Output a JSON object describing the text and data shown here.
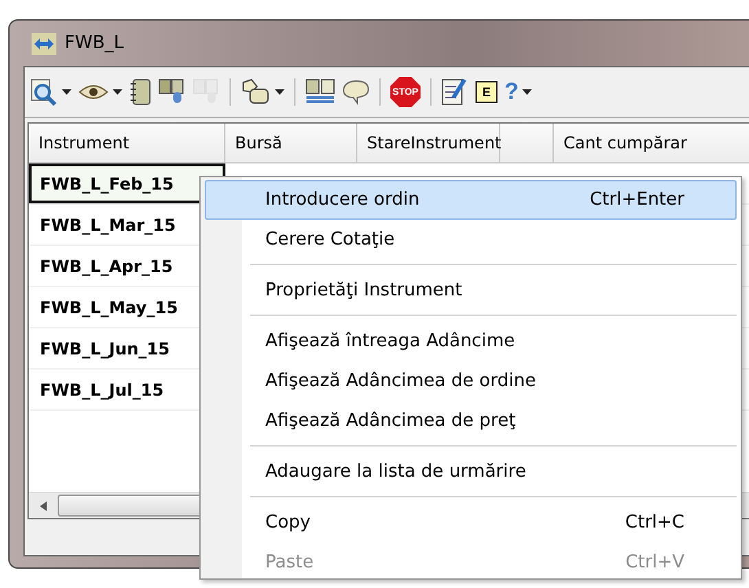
{
  "window": {
    "title": "FWB_L"
  },
  "toolbar": [
    {
      "kind": "zoom",
      "disabled": false
    },
    {
      "kind": "caret",
      "disabled": false
    },
    {
      "kind": "eye",
      "disabled": false
    },
    {
      "kind": "caret",
      "disabled": false
    },
    {
      "kind": "notebook",
      "disabled": false
    },
    {
      "kind": "windows",
      "disabled": false
    },
    {
      "kind": "windows",
      "disabled": true
    },
    {
      "kind": "sep"
    },
    {
      "kind": "shapes",
      "disabled": false
    },
    {
      "kind": "caret",
      "disabled": false
    },
    {
      "kind": "sep"
    },
    {
      "kind": "layout",
      "disabled": false
    },
    {
      "kind": "bubble",
      "disabled": false
    },
    {
      "kind": "sep"
    },
    {
      "kind": "stop",
      "glyph": "STOP",
      "disabled": false
    },
    {
      "kind": "sep"
    },
    {
      "kind": "checklist",
      "disabled": false
    },
    {
      "kind": "letter",
      "glyph": "E",
      "disabled": false
    },
    {
      "kind": "help",
      "glyph": "?",
      "disabled": false
    },
    {
      "kind": "caret",
      "disabled": false
    }
  ],
  "table": {
    "columns": [
      "Instrument",
      "Bursă",
      "StareInstrument",
      "Cant cumpărar"
    ],
    "rows": [
      {
        "instrument": "FWB_L_Feb_15",
        "selected": true
      },
      {
        "instrument": "FWB_L_Mar_15",
        "selected": false
      },
      {
        "instrument": "FWB_L_Apr_15",
        "selected": false
      },
      {
        "instrument": "FWB_L_May_15",
        "selected": false
      },
      {
        "instrument": "FWB_L_Jun_15",
        "selected": false
      },
      {
        "instrument": "FWB_L_Jul_15",
        "selected": false
      }
    ]
  },
  "context_menu": [
    {
      "kind": "item",
      "label": "Introducere ordin",
      "shortcut": "Ctrl+Enter",
      "selected": true,
      "disabled": false
    },
    {
      "kind": "item",
      "label": "Cerere Cotaţie",
      "selected": false,
      "disabled": false
    },
    {
      "kind": "separator"
    },
    {
      "kind": "item",
      "label": "Proprietăţi Instrument",
      "selected": false,
      "disabled": false
    },
    {
      "kind": "separator"
    },
    {
      "kind": "item",
      "label": "Afişează întreaga Adâncime",
      "selected": false,
      "disabled": false
    },
    {
      "kind": "item",
      "label": "Afişează Adâncimea de ordine",
      "selected": false,
      "disabled": false
    },
    {
      "kind": "item",
      "label": "Afişează Adâncimea de preţ",
      "selected": false,
      "disabled": false
    },
    {
      "kind": "separator"
    },
    {
      "kind": "item",
      "label": "Adaugare la lista de urmărire",
      "selected": false,
      "disabled": false
    },
    {
      "kind": "separator"
    },
    {
      "kind": "item",
      "label": "Copy",
      "shortcut": "Ctrl+C",
      "selected": false,
      "disabled": false
    },
    {
      "kind": "item",
      "label": "Paste",
      "shortcut": "Ctrl+V",
      "selected": false,
      "disabled": true
    }
  ]
}
